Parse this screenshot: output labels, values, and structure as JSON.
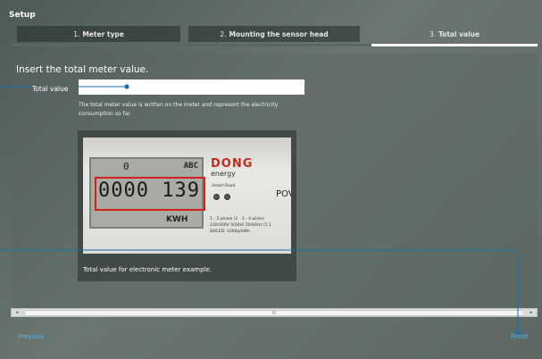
{
  "window": {
    "title": "Setup"
  },
  "steps": [
    {
      "number": "1.",
      "label": "Meter type"
    },
    {
      "number": "2.",
      "label": "Mounting the sensor head"
    },
    {
      "number": "3.",
      "label": "Total value"
    }
  ],
  "form": {
    "heading": "Insert the total meter value.",
    "label": "Total value",
    "value": "",
    "help": "The total meter value is written on the meter and represent the electricity consumption so far."
  },
  "image": {
    "caption": "Total value for electronic meter example.",
    "meter": {
      "lcd_top": "0",
      "lcd_abc": "ABC",
      "digits": "0000 139",
      "unit": "KWH",
      "brand": "DONG",
      "brand_sub": "energy",
      "smart": "Smart Read",
      "specs": "1 - 3 phase (2 - 3 - 4 wires)\n230/400V 5(60)A 50/60Hz Cl.1\nS0/LED: 1000p/kWh",
      "side": "POV"
    }
  },
  "scrollbar": {
    "grip": "III",
    "left_arrow": "◂",
    "right_arrow": "▸"
  },
  "nav": {
    "previous": "Previous",
    "finish": "Finish"
  },
  "colors": {
    "accent": "#5bb3e6",
    "highlight": "#d02020",
    "brand": "#c32b1e"
  }
}
